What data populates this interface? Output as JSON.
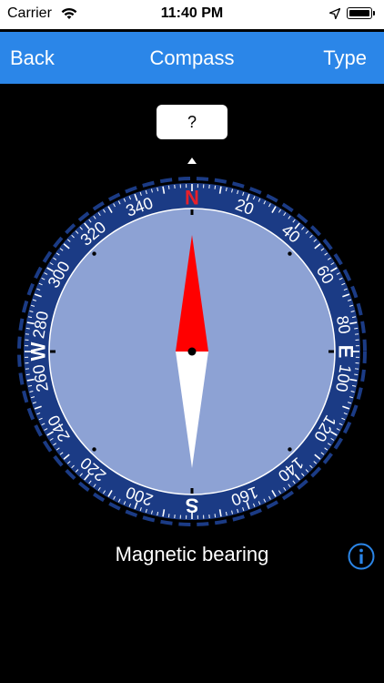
{
  "status_bar": {
    "carrier": "Carrier",
    "time": "11:40 PM"
  },
  "nav": {
    "back_label": "Back",
    "title": "Compass",
    "type_label": "Type"
  },
  "bearing": {
    "value": "?"
  },
  "compass": {
    "heading_deg": 0,
    "needle_deg": 0,
    "colors": {
      "dark_ring": "#1b3b85",
      "face": "#8da2d4",
      "north": "#e8202a",
      "needle_north": "#ff0000",
      "needle_south": "#ffffff"
    },
    "cardinals": [
      {
        "label": "N",
        "deg": 0,
        "color": "#e8202a"
      },
      {
        "label": "E",
        "deg": 90,
        "color": "#ffffff"
      },
      {
        "label": "S",
        "deg": 180,
        "color": "#ffffff"
      },
      {
        "label": "W",
        "deg": 270,
        "color": "#ffffff"
      }
    ],
    "numbers": [
      "20",
      "40",
      "60",
      "80",
      "100",
      "120",
      "140",
      "160",
      "200",
      "220",
      "240",
      "260",
      "280",
      "300",
      "320",
      "340"
    ]
  },
  "footer": {
    "label": "Magnetic bearing"
  },
  "icons": {
    "wifi": "wifi-icon",
    "location": "location-arrow-icon",
    "battery": "battery-icon",
    "info": "info-icon"
  }
}
